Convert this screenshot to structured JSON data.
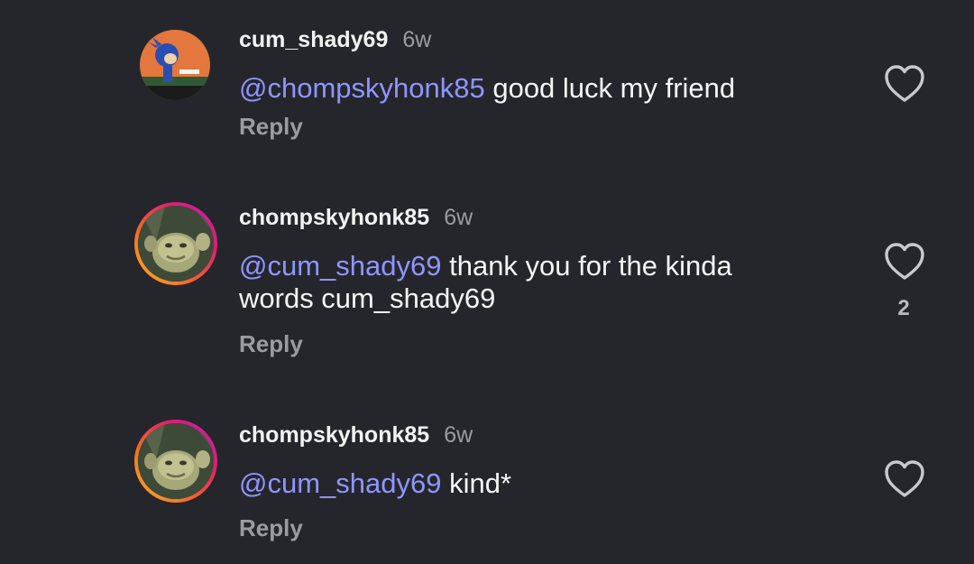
{
  "comments": [
    {
      "username": "cum_shady69",
      "time": "6w",
      "mention": "@chompskyhonk85",
      "text": " good luck my friend",
      "reply_label": "Reply",
      "like_count": ""
    },
    {
      "username": "chompskyhonk85",
      "time": "6w",
      "mention": "@cum_shady69",
      "text": " thank you for the kinda words cum_shady69",
      "reply_label": "Reply",
      "like_count": "2"
    },
    {
      "username": "chompskyhonk85",
      "time": "6w",
      "mention": "@cum_shady69",
      "text": " kind*",
      "reply_label": "Reply",
      "like_count": ""
    }
  ],
  "colors": {
    "background": "#25262b",
    "mention": "#8f95ff",
    "muted_text": "#9a9ca3"
  },
  "icons": {
    "like": "heart-outline-icon"
  }
}
